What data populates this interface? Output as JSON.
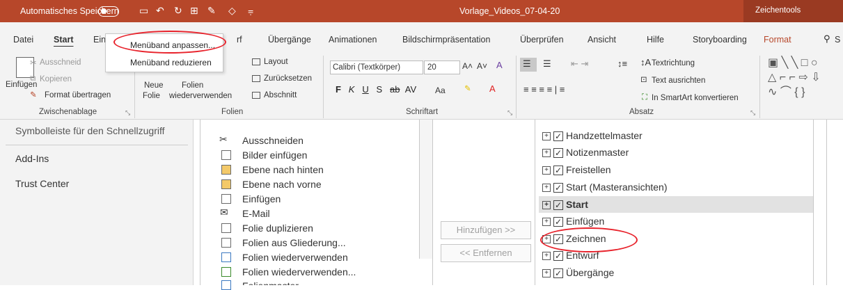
{
  "titlebar": {
    "autosave": "Automatisches Speichern",
    "filename": "Vorlage_Videos_07-04-20",
    "context_tab": "Zeichentools"
  },
  "tabs": [
    "Datei",
    "Start",
    "Einf",
    "Entwurf",
    "Übergänge",
    "Animationen",
    "Bildschirmpräsentation",
    "Überprüfen",
    "Ansicht",
    "Hilfe",
    "Storyboarding",
    "Format"
  ],
  "search_letter": "S",
  "context_menu": {
    "item1": "Menüband anpassen...",
    "item2": "Menüband reduzieren"
  },
  "ribbon": {
    "clipboard": {
      "einfuegen": "Einfügen",
      "ausschneiden": "Ausschneid",
      "kopieren": "Kopieren",
      "format": "Format übertragen",
      "label": "Zwischenablage"
    },
    "folien": {
      "neue1": "Neue",
      "neue2": "Folie",
      "folien1": "Folien",
      "folien2": "wiederverwenden",
      "layout": "Layout",
      "zuruecksetzen": "Zurücksetzen",
      "abschnitt": "Abschnitt",
      "label": "Folien"
    },
    "schriftart": {
      "font": "Calibri (Textkörper)",
      "size": "20",
      "aa": "Aa",
      "label": "Schriftart"
    },
    "absatz": {
      "textrichtung": "Textrichtung",
      "ausrichten": "Text ausrichten",
      "smartart": "In SmartArt konvertieren",
      "label": "Absatz"
    }
  },
  "left_nav": {
    "partial": "Symbolleiste für den Schnellzugriff",
    "items": [
      "Add-Ins",
      "Trust Center"
    ]
  },
  "commands": [
    "Ausschneiden",
    "Bilder einfügen",
    "Ebene nach hinten",
    "Ebene nach vorne",
    "Einfügen",
    "E-Mail",
    "Folie duplizieren",
    "Folien aus Gliederung...",
    "Folien wiederverwenden",
    "Folien wiederverwenden...",
    "Folienmaster"
  ],
  "buttons": {
    "add": "Hinzufügen >>",
    "remove": "<< Entfernen"
  },
  "tree": [
    "Handzettelmaster",
    "Notizenmaster",
    "Freistellen",
    "Start (Masteransichten)",
    "Start",
    "Einfügen",
    "Zeichnen",
    "Entwurf",
    "Übergänge"
  ]
}
